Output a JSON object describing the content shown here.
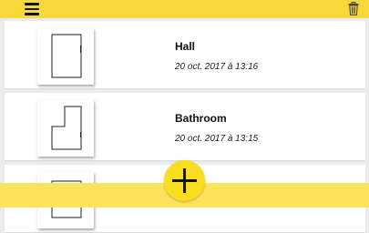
{
  "header": {
    "menu_icon": "hamburger-menu-icon",
    "trash_icon": "trash-icon",
    "accent_color": "#f9d83a"
  },
  "plans": [
    {
      "title": "Hall",
      "date": "20 oct. 2017 à 13:16",
      "thumbnail_icon": "floor-plan-rectangle"
    },
    {
      "title": "Bathroom",
      "date": "20 oct. 2017 à 13:15",
      "thumbnail_icon": "floor-plan-l-shape"
    },
    {
      "title": "",
      "date": "",
      "thumbnail_icon": "floor-plan-partial"
    }
  ],
  "fab": {
    "icon": "plus-icon",
    "color": "#f9de1f"
  },
  "footer": {
    "color": "#fde35c"
  }
}
